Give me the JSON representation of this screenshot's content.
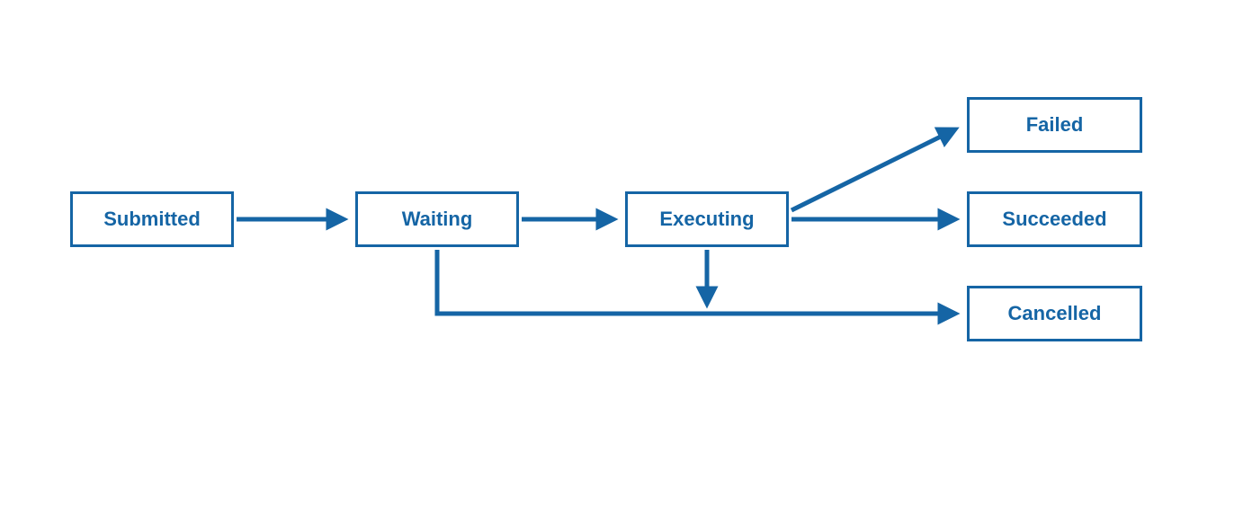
{
  "states": {
    "submitted": "Submitted",
    "waiting": "Waiting",
    "executing": "Executing",
    "failed": "Failed",
    "succeeded": "Succeeded",
    "cancelled": "Cancelled"
  },
  "colors": {
    "primary": "#1565a5"
  },
  "transitions": [
    {
      "from": "Submitted",
      "to": "Waiting"
    },
    {
      "from": "Waiting",
      "to": "Executing"
    },
    {
      "from": "Executing",
      "to": "Failed"
    },
    {
      "from": "Executing",
      "to": "Succeeded"
    },
    {
      "from": "Executing",
      "to": "Cancelled"
    },
    {
      "from": "Waiting",
      "to": "Cancelled"
    }
  ]
}
